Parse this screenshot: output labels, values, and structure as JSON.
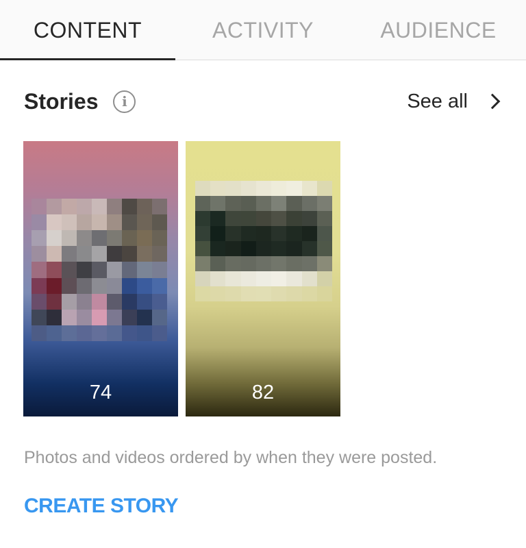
{
  "tabs": [
    {
      "label": "CONTENT",
      "active": true
    },
    {
      "label": "ACTIVITY",
      "active": false
    },
    {
      "label": "AUDIENCE",
      "active": false
    }
  ],
  "stories_section": {
    "title": "Stories",
    "info_icon": "info-icon",
    "see_all_label": "See all",
    "see_all_icon": "chevron-right-icon",
    "items": [
      {
        "count": "74"
      },
      {
        "count": "82"
      }
    ],
    "caption": "Photos and videos ordered by when they were posted.",
    "create_label": "CREATE STORY"
  },
  "colors": {
    "accent": "#3897f0",
    "text_primary": "#262626",
    "text_secondary": "#9a9a9a",
    "tab_inactive": "#a6a6a6"
  }
}
